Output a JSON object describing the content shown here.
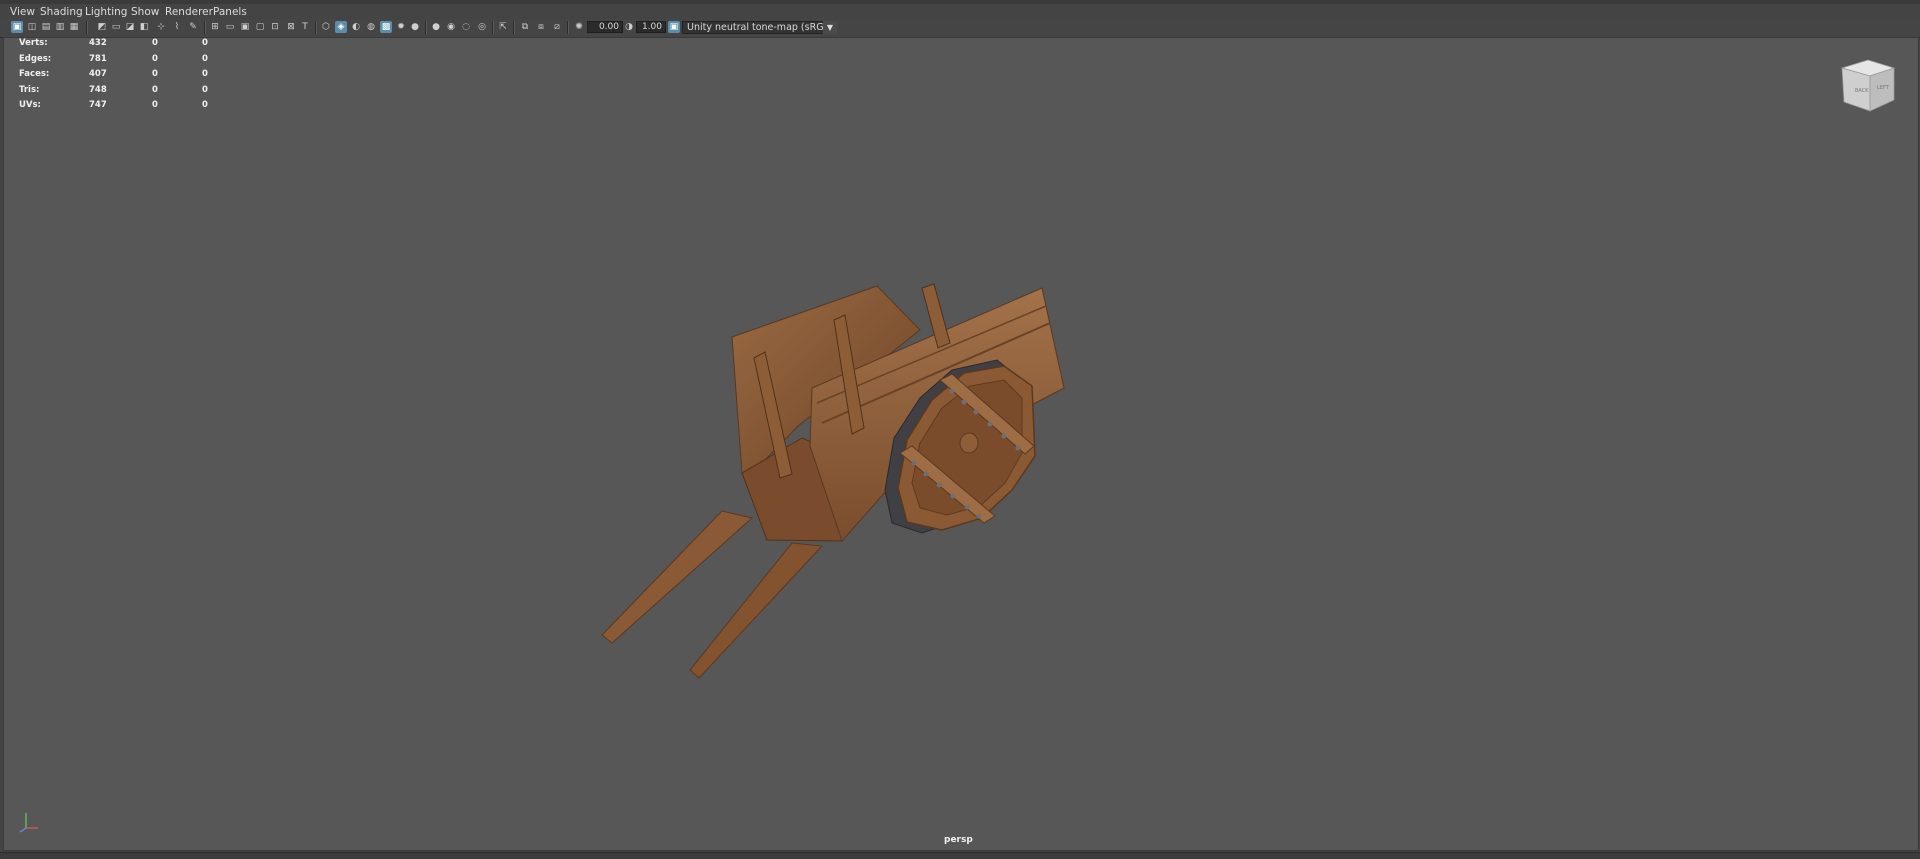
{
  "menubar": {
    "items": [
      "View",
      "Shading",
      "Lighting",
      "Show",
      "Renderer",
      "Panels"
    ]
  },
  "toolbar": {
    "icons": [
      "select-camera-icon",
      "lock-camera-icon",
      "camera-attributes-icon",
      "bookmarks-icon",
      "image-plane-icon",
      "grid-icon",
      "film-gate-icon",
      "resolution-gate-icon",
      "gate-mask-icon",
      "field-chart-icon",
      "safe-action-icon",
      "safe-title-icon",
      "wireframe-icon",
      "smooth-shade-icon",
      "default-material-icon",
      "textured-icon",
      "use-lights-icon",
      "shadows-icon",
      "screen-space-ao-icon",
      "motion-blur-icon",
      "anti-alias-icon",
      "depth-of-field-icon",
      "isolate-select-icon",
      "xray-icon",
      "xray-joints-icon",
      "backface-culling-icon",
      "exposure-icon",
      "gamma-icon",
      "color-management-icon"
    ],
    "exposure_value": "0.00",
    "gamma_value": "1.00",
    "view_transform": "Unity neutral tone-map (sRGB)"
  },
  "hud": {
    "rows": [
      {
        "label": "Verts:",
        "object": "432",
        "selected": "0",
        "uv": "0"
      },
      {
        "label": "Edges:",
        "object": "781",
        "selected": "0",
        "uv": "0"
      },
      {
        "label": "Faces:",
        "object": "407",
        "selected": "0",
        "uv": "0"
      },
      {
        "label": "Tris:",
        "object": "748",
        "selected": "0",
        "uv": "0"
      },
      {
        "label": "UVs:",
        "object": "747",
        "selected": "0",
        "uv": "0"
      }
    ]
  },
  "viewcube": {
    "face_front": "BACK",
    "face_side": "LEFT"
  },
  "viewport": {
    "camera": "persp"
  },
  "colors": {
    "accent": "#5a8eaa",
    "viewport_bg": "#575757",
    "wood": "#8a5a34"
  }
}
